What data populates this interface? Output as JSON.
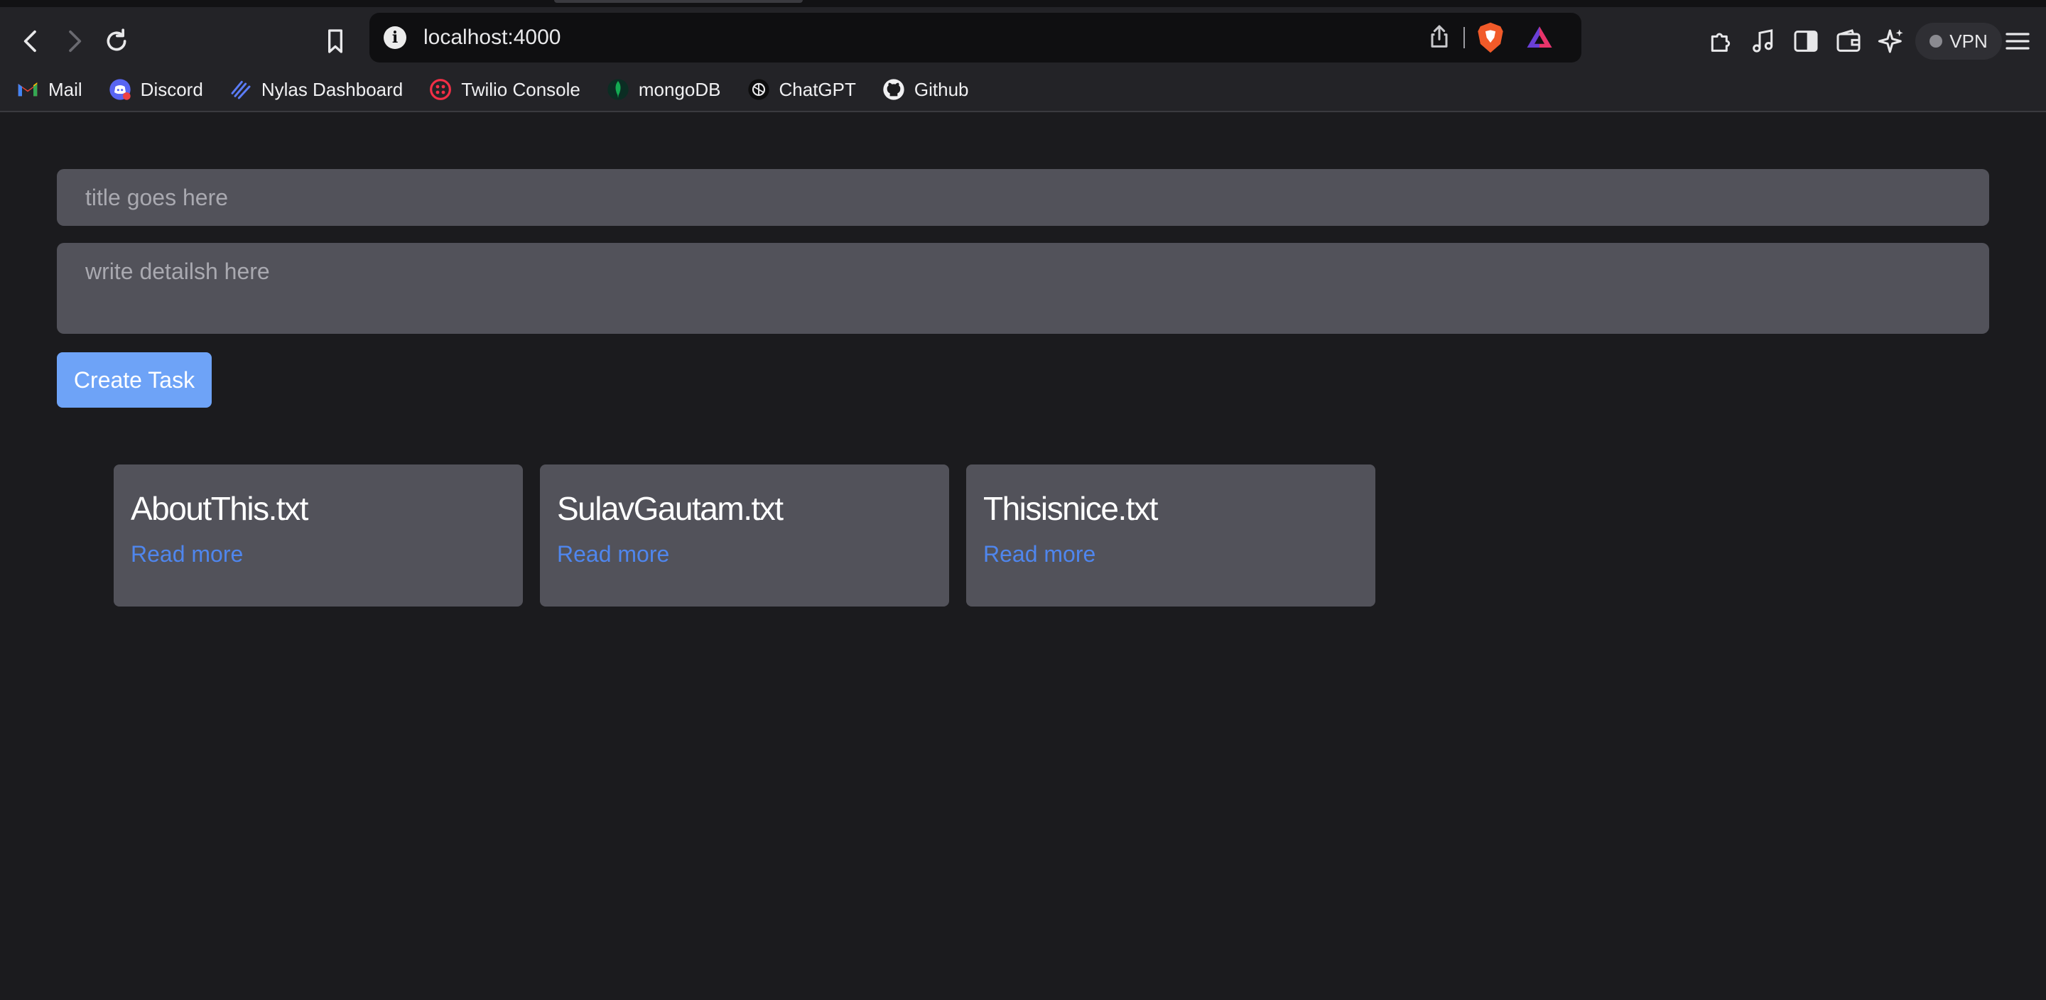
{
  "browser": {
    "url": "localhost:4000",
    "vpn_label": "VPN",
    "bookmarks": [
      {
        "label": "Mail",
        "icon": "gmail-icon"
      },
      {
        "label": "Discord",
        "icon": "discord-icon"
      },
      {
        "label": "Nylas Dashboard",
        "icon": "nylas-icon"
      },
      {
        "label": "Twilio Console",
        "icon": "twilio-icon"
      },
      {
        "label": "mongoDB",
        "icon": "mongodb-icon"
      },
      {
        "label": "ChatGPT",
        "icon": "chatgpt-icon"
      },
      {
        "label": "Github",
        "icon": "github-icon"
      }
    ]
  },
  "form": {
    "title_placeholder": "title goes here",
    "title_value": "",
    "details_placeholder": "write detailsh here",
    "details_value": "",
    "submit_label": "Create Task"
  },
  "tasks": [
    {
      "title": "AboutThis.txt",
      "link": "Read more"
    },
    {
      "title": "SulavGautam.txt",
      "link": "Read more"
    },
    {
      "title": "Thisisnice.txt",
      "link": "Read more"
    }
  ],
  "colors": {
    "page_background": "#1b1b1e",
    "field_background": "#52525a",
    "button_background": "#6ea3f7",
    "link": "#4f86ee",
    "card_background": "#52525a"
  }
}
